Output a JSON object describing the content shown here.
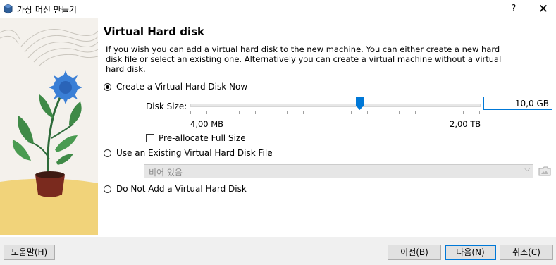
{
  "window": {
    "title": "가상 머신 만들기",
    "help_glyph": "?",
    "close_glyph": "✕"
  },
  "page": {
    "heading": "Virtual Hard disk",
    "description": "If you wish you can add a virtual hard disk to the new machine. You can either create a new hard disk file or select an existing one. Alternatively you can create a virtual machine without a virtual hard disk."
  },
  "options": {
    "create_new": {
      "label": "Create a Virtual Hard Disk Now",
      "selected": true
    },
    "use_existing": {
      "label": "Use an Existing Virtual Hard Disk File",
      "selected": false
    },
    "no_disk": {
      "label": "Do Not Add a Virtual Hard Disk",
      "selected": false
    }
  },
  "disk_size": {
    "label": "Disk Size:",
    "value": "10,0 GB",
    "min_label": "4,00 MB",
    "max_label": "2,00 TB",
    "slider_position": 0.57
  },
  "preallocate": {
    "label": "Pre-allocate Full Size",
    "checked": false
  },
  "existing_file": {
    "value": "비어 있음"
  },
  "buttons": {
    "help": "도움말(H)",
    "back": "이전(B)",
    "next": "다음(N)",
    "cancel": "취소(C)"
  },
  "colors": {
    "accent": "#0078d7",
    "flower": "#3a7fd6",
    "pot": "#7a2a1e",
    "sand": "#f1d37a"
  }
}
